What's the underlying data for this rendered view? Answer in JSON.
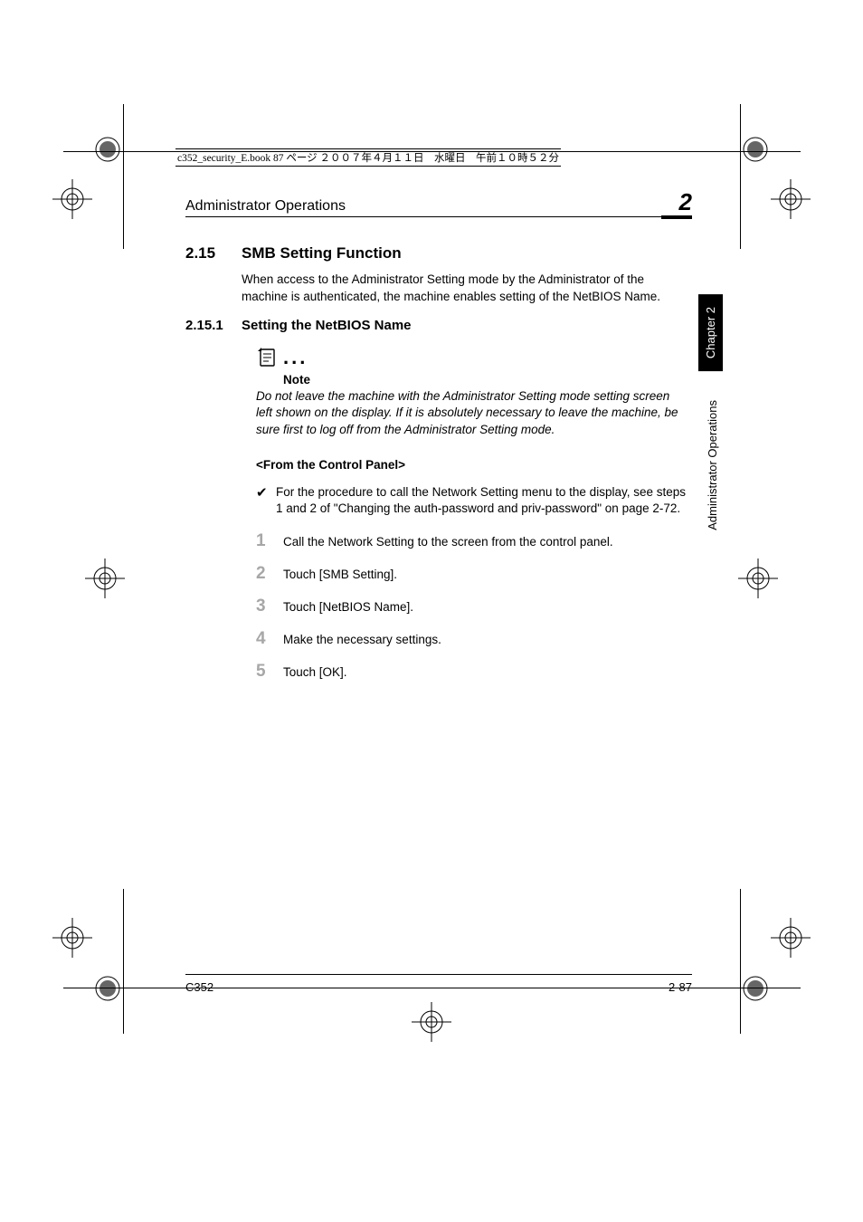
{
  "file_header": "c352_security_E.book  87 ページ  ２００７年４月１１日　水曜日　午前１０時５２分",
  "running_head": "Administrator Operations",
  "chapter_number": "2",
  "section": {
    "number": "2.15",
    "title": "SMB Setting Function",
    "intro": "When access to the Administrator Setting mode by the Administrator of the machine is authenticated, the machine enables setting of the NetBIOS Name."
  },
  "subsection": {
    "number": "2.15.1",
    "title": "Setting the NetBIOS Name"
  },
  "note": {
    "label": "Note",
    "body": "Do not leave the machine with the Administrator Setting mode setting screen left shown on the display. If it is absolutely necessary to leave the machine, be sure first to log off from the Administrator Setting mode."
  },
  "subhead": "<From the Control Panel>",
  "bullet": "For the procedure to call the Network Setting menu to the display, see steps 1 and 2 of \"Changing the auth-password and priv-password\" on page 2-72.",
  "steps": [
    "Call the Network Setting to the screen from the control panel.",
    "Touch [SMB Setting].",
    "Touch [NetBIOS Name].",
    "Make the necessary settings.",
    "Touch [OK]."
  ],
  "footer": {
    "left": "C352",
    "right": "2-87"
  },
  "side_tabs": {
    "chapter": "Chapter 2",
    "title": "Administrator Operations"
  }
}
